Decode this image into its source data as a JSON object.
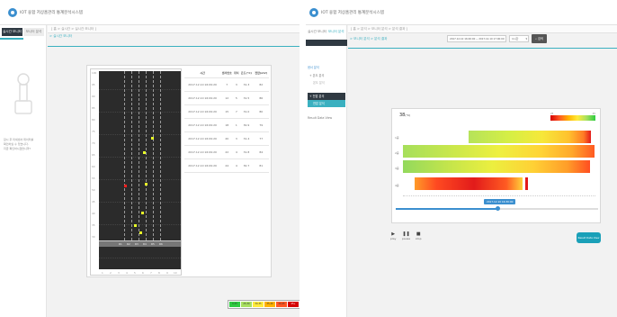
{
  "left": {
    "app_title": "IOT 융합 저상홈관리 통계분석시스템",
    "side_tabs": [
      "실시간 모니터",
      "모니터 분석"
    ],
    "breadcrumb": "[ 홈 > 실시간 > 실시간 모니터 ]",
    "panel_tab": "> 실시간 모니터",
    "side_note": [
      "잠시 후 미세센서 데이터를",
      "확인하실 수 있습니다.",
      "지금 확인하시겠습니까?"
    ],
    "table": {
      "headers": [
        "시간",
        "센서번호",
        "위치",
        "온도(°C)",
        "전압(mV)"
      ],
      "rows": [
        [
          "2017.12.10 16:09:20",
          "7",
          "3",
          "31.3",
          "82"
        ],
        [
          "2017.12.10 16:09:20",
          "12",
          "5",
          "31.5",
          "86"
        ],
        [
          "2017.12.10 16:09:20",
          "15",
          "7",
          "31.0",
          "80"
        ],
        [
          "2017.12.10 16:09:20",
          "18",
          "1",
          "30.9",
          "79"
        ],
        [
          "2017.12.10 16:09:20",
          "20",
          "3",
          "31.4",
          "77"
        ],
        [
          "2017.12.10 16:09:20",
          "22",
          "4",
          "31.8",
          "84"
        ],
        [
          "2017.12.10 16:09:20",
          "24",
          "4",
          "30.7",
          "81"
        ]
      ]
    },
    "y_ticks": [
      "100",
      "95",
      "90",
      "85",
      "80",
      "75",
      "70",
      "65",
      "60",
      "55",
      "50",
      "45",
      "40",
      "35",
      "30"
    ],
    "lane_labels": [
      "R1",
      "R2",
      "R3",
      "R4",
      "R5",
      "R6"
    ],
    "x_ticks": [
      "1",
      "2",
      "3",
      "4",
      "5",
      "6",
      "7",
      "8",
      "9",
      "10"
    ],
    "legend": [
      "0-25",
      "25-30",
      "30-35",
      "35-40",
      "40-45",
      "45+"
    ],
    "legend_colors": [
      "#2ecc40",
      "#a8e05f",
      "#ffeb3b",
      "#ffb300",
      "#ff5722",
      "#d50000"
    ]
  },
  "right": {
    "app_title": "IOT 융합 저상홈관리 통계분석시스템",
    "side_tabs": [
      "실시간 모니터",
      "모니터 분석"
    ],
    "breadcrumb": "[ 홈 > 분석 > 모니터 분석 > 분석 결과 ]",
    "panel_tab": "> 모니터 분석 > 분석 결과",
    "date_range": "2017.12.10 16:00:00 ~ 2017.12.10 17:00:00",
    "select_value": "1시간",
    "search_button": "검색",
    "menu": [
      "센서 분석",
      "+ 온도 분석",
      "온도 분석",
      "+ 전압 분석",
      "전압 분석",
      "Result Data View"
    ],
    "big_value": "38",
    "big_unit": "(°C)",
    "legend_min": "25",
    "legend_max": "45",
    "row_labels": [
      "1층",
      "2층",
      "3층",
      "4층"
    ],
    "time_label": "2017.12.10 16:30:00",
    "controls": [
      "play",
      "pause",
      "stop"
    ],
    "result_button": "Result Data View"
  }
}
